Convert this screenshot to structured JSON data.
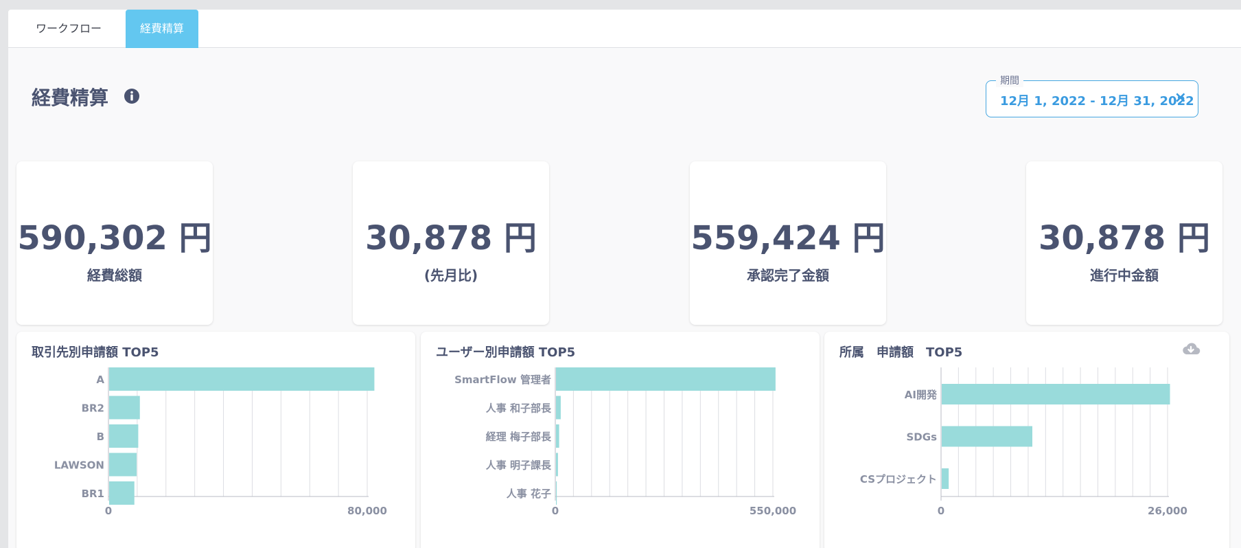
{
  "tabs": [
    {
      "label": "ワークフロー",
      "active": false
    },
    {
      "label": "経費精算",
      "active": true
    }
  ],
  "page": {
    "title": "経費精算",
    "info_icon": "info-icon"
  },
  "period": {
    "label": "期間",
    "value": "12月 1, 2022 - 12月 31, 2022",
    "clear_icon": "×"
  },
  "kpis": [
    {
      "value": "590,302 円",
      "label": "経費総額"
    },
    {
      "value": "30,878 円",
      "label": "(先月比)"
    },
    {
      "value": "559,424 円",
      "label": "承認完了金額"
    },
    {
      "value": "30,878 円",
      "label": "進行中金額"
    }
  ],
  "colors": {
    "bar": "#99dbdb",
    "accent": "#45a6e0",
    "tab_active": "#63c7f0",
    "text": "#4a5370"
  },
  "chart_data": [
    {
      "type": "bar",
      "orientation": "horizontal",
      "title": "取引先別申請額 TOP5",
      "categories": [
        "A",
        "BR2",
        "B",
        "LAWSON",
        "BR1"
      ],
      "values": [
        82000,
        9500,
        9000,
        8500,
        7800
      ],
      "xlim": [
        0,
        80000
      ],
      "xticks": [
        "0",
        "80,000"
      ],
      "grid": true
    },
    {
      "type": "bar",
      "orientation": "horizontal",
      "title": "ユーザー別申請額 TOP5",
      "categories": [
        "SmartFlow 管理者",
        "人事 和子部長",
        "経理 梅子部長",
        "人事 明子課長",
        "人事 花子"
      ],
      "values": [
        555000,
        12000,
        8000,
        5000,
        2000
      ],
      "xlim": [
        0,
        550000
      ],
      "xticks": [
        "0",
        "550,000"
      ],
      "grid": true
    },
    {
      "type": "bar",
      "orientation": "horizontal",
      "title": "所属　申請額　TOP5",
      "categories": [
        "AI開発",
        "SDGs",
        "CSプロジェクト"
      ],
      "values": [
        26200,
        10400,
        800
      ],
      "xlim": [
        0,
        26000
      ],
      "xticks": [
        "0",
        "26,000"
      ],
      "grid": true
    }
  ]
}
